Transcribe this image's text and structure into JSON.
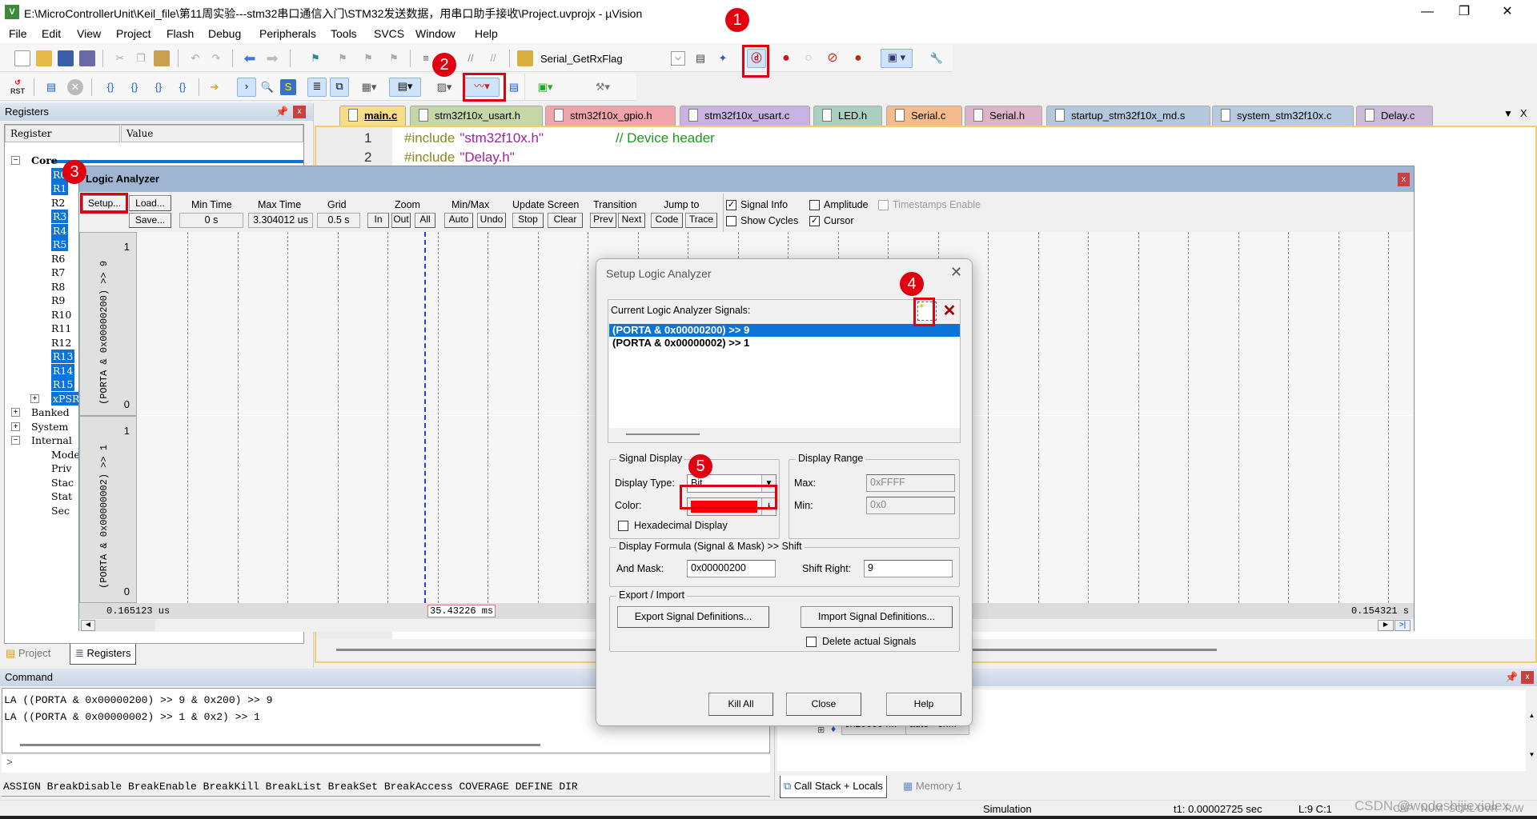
{
  "window": {
    "title": "E:\\MicroControllerUnit\\Keil_file\\第11周实验---stm32串口通信入门\\STM32发送数据，用串口助手接收\\Project.uvprojx - µVision",
    "app_icon": "keil-uvision-icon"
  },
  "menu": [
    "File",
    "Edit",
    "View",
    "Project",
    "Flash",
    "Debug",
    "Peripherals",
    "Tools",
    "SVCS",
    "Window",
    "Help"
  ],
  "toolbar": {
    "function_combo": "Serial_GetRxFlag",
    "reset_label": "RST"
  },
  "annotations": [
    "1",
    "2",
    "3",
    "4",
    "5"
  ],
  "registers_panel": {
    "title": "Registers",
    "columns": [
      "Register",
      "Value"
    ],
    "rows": [
      {
        "label": "Core",
        "level": 0,
        "expander": "−",
        "bold": true
      },
      {
        "label": "R0",
        "level": 1,
        "sel": true
      },
      {
        "label": "R1",
        "level": 1,
        "sel": true
      },
      {
        "label": "R2",
        "level": 1
      },
      {
        "label": "R3",
        "level": 1,
        "sel": true
      },
      {
        "label": "R4",
        "level": 1,
        "sel": true
      },
      {
        "label": "R5",
        "level": 1,
        "sel": true
      },
      {
        "label": "R6",
        "level": 1
      },
      {
        "label": "R7",
        "level": 1
      },
      {
        "label": "R8",
        "level": 1
      },
      {
        "label": "R9",
        "level": 1
      },
      {
        "label": "R10",
        "level": 1
      },
      {
        "label": "R11",
        "level": 1
      },
      {
        "label": "R12",
        "level": 1
      },
      {
        "label": "R13",
        "level": 1,
        "sel": true
      },
      {
        "label": "R14",
        "level": 1,
        "sel": true
      },
      {
        "label": "R15",
        "level": 1,
        "sel": true
      },
      {
        "label": "xPSR",
        "level": 1,
        "sel": true,
        "expander": "+"
      },
      {
        "label": "Banked",
        "level": 0,
        "expander": "+"
      },
      {
        "label": "System",
        "level": 0,
        "expander": "+"
      },
      {
        "label": "Internal",
        "level": 0,
        "expander": "−"
      },
      {
        "label": "Mode",
        "level": 1
      },
      {
        "label": "Priv",
        "level": 1
      },
      {
        "label": "Stac",
        "level": 1
      },
      {
        "label": "Stat",
        "level": 1
      },
      {
        "label": "Sec",
        "level": 1
      }
    ],
    "bottom_tabs": [
      "Project",
      "Registers"
    ]
  },
  "editor": {
    "tabs": [
      {
        "label": "main.c",
        "color": "#f7de86",
        "active": true
      },
      {
        "label": "stm32f10x_usart.h",
        "color": "#c6d7a6"
      },
      {
        "label": "stm32f10x_gpio.h",
        "color": "#f1a5aa"
      },
      {
        "label": "stm32f10x_usart.c",
        "color": "#c9b3e3"
      },
      {
        "label": "LED.h",
        "color": "#a9cfc1"
      },
      {
        "label": "Serial.c",
        "color": "#f6bb8d"
      },
      {
        "label": "Serial.h",
        "color": "#dcb3c9"
      },
      {
        "label": "startup_stm32f10x_md.s",
        "color": "#b2c9dd"
      },
      {
        "label": "system_stm32f10x.c",
        "color": "#b6cbe0"
      },
      {
        "label": "Delay.c",
        "color": "#cbbbd9"
      }
    ],
    "lines": [
      {
        "num": "1",
        "kw": "#include",
        "str": "\"stm32f10x.h\"",
        "comment": "// Device header"
      },
      {
        "num": "2",
        "kw": "#include",
        "str": "\"Delay.h\"",
        "comment": ""
      }
    ]
  },
  "logic_analyzer": {
    "title": "Logic Analyzer",
    "setup": "Setup...",
    "load": "Load...",
    "save": "Save...",
    "min_time_label": "Min Time",
    "min_time": "0 s",
    "max_time_label": "Max Time",
    "max_time": "3.304012 us",
    "grid_label": "Grid",
    "grid": "0.5 s",
    "zoom_label": "Zoom",
    "zoom_in": "In",
    "zoom_out": "Out",
    "zoom_all": "All",
    "minmax_label": "Min/Max",
    "auto": "Auto",
    "undo": "Undo",
    "update_label": "Update Screen",
    "stop": "Stop",
    "clear": "Clear",
    "transition_label": "Transition",
    "prev": "Prev",
    "next": "Next",
    "jump_label": "Jump to",
    "code": "Code",
    "trace": "Trace",
    "signal_info": {
      "label": "Signal Info",
      "checked": true
    },
    "amplitude": {
      "label": "Amplitude",
      "checked": false
    },
    "timestamps": {
      "label": "Timestamps Enable",
      "checked": false,
      "disabled": true
    },
    "show_cycles": {
      "label": "Show Cycles",
      "checked": false
    },
    "cursor": {
      "label": "Cursor",
      "checked": true
    },
    "signals": [
      {
        "name": "(PORTA & 0x00000200) >> 9",
        "max": "1",
        "min": "0"
      },
      {
        "name": "(PORTA & 0x00000002) >> 1",
        "max": "1",
        "min": "0"
      }
    ],
    "time_start": "0.165123 us",
    "cursor_time": "35.43226 ms",
    "time_end": "0.154321 s"
  },
  "setup_dialog": {
    "title": "Setup Logic Analyzer",
    "signals_label": "Current Logic Analyzer Signals:",
    "signals": [
      "(PORTA & 0x00000200) >> 9",
      "(PORTA & 0x00000002) >> 1"
    ],
    "selected_index": 0,
    "signal_display": "Signal Display",
    "display_type_label": "Display Type:",
    "display_type": "Bit",
    "color_label": "Color:",
    "color": "#ff0000",
    "hex_display": "Hexadecimal Display",
    "display_range": "Display Range",
    "max_label": "Max:",
    "max": "0xFFFF",
    "min_label": "Min:",
    "min": "0x0",
    "formula_label": "Display Formula (Signal & Mask) >> Shift",
    "and_mask_label": "And Mask:",
    "and_mask": "0x00000200",
    "shift_label": "Shift Right:",
    "shift": "9",
    "export_import": "Export / Import",
    "export_btn": "Export Signal Definitions...",
    "import_btn": "Import Signal Definitions...",
    "delete_signals": "Delete actual Signals",
    "kill_all": "Kill All",
    "close": "Close",
    "help": "Help"
  },
  "command": {
    "title": "Command",
    "output": [
      "LA ((PORTA & 0x00000200) >> 9 & 0x200) >> 9",
      "LA ((PORTA & 0x00000002) >> 1 & 0x2) >> 1"
    ],
    "prompt": ">",
    "hints": "ASSIGN BreakDisable BreakEnable BreakKill BreakList BreakSet BreakAccess COVERAGE DEFINE DIR"
  },
  "callstack": {
    "rows": [
      [
        "0x200004...",
        "auto - ch..."
      ]
    ],
    "tabs": [
      "Call Stack + Locals",
      "Memory 1"
    ]
  },
  "statusbar": {
    "mode": "Simulation",
    "t1": "t1: 0.00002725 sec",
    "pos": "L:9 C:1",
    "flags": [
      "CAP",
      "NUM",
      "SCRL",
      "OVR",
      "R/W"
    ]
  },
  "watermark": "CSDN @wodeshijiexialex"
}
